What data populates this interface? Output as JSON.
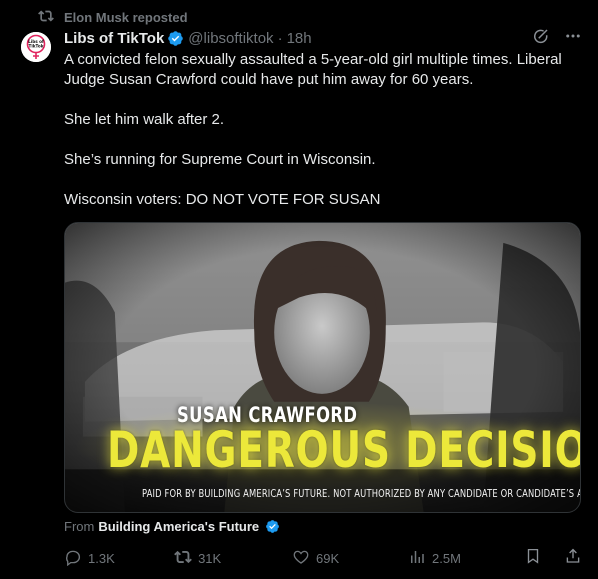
{
  "repost": {
    "label": "Elon Musk reposted",
    "icon": "repost-icon"
  },
  "author": {
    "name": "Libs of TikTok",
    "handle": "@libsoftiktok",
    "separator": "·",
    "time": "18h",
    "verified_color": "#1d9bf0",
    "avatar_label": "Libs of TikTok"
  },
  "body": {
    "paragraphs": [
      "A convicted felon sexually assaulted a 5-year-old girl multiple times. Liberal Judge Susan Crawford could have put him away for 60 years.",
      "She let him walk after 2.",
      "She’s running for Supreme Court in Wisconsin.",
      "Wisconsin voters: DO NOT VOTE FOR SUSAN"
    ]
  },
  "media": {
    "name_overlay": "SUSAN CRAWFORD",
    "headline_overlay": "DANGEROUS DECISIONS",
    "disclaimer": "PAID FOR BY BUILDING AMERICA’S FUTURE. NOT AUTHORIZED BY ANY CANDIDATE OR CANDIDATE’S AGENT OR COMMITTEE.",
    "headline_color": "#ece83a"
  },
  "source": {
    "prefix": "From",
    "name": "Building America's Future"
  },
  "actions": {
    "replies": "1.3K",
    "reposts": "31K",
    "likes": "69K",
    "views": "2.5M"
  },
  "colors": {
    "background": "#000000",
    "text": "#e7e9ea",
    "muted": "#71767b",
    "accent": "#1d9bf0"
  }
}
